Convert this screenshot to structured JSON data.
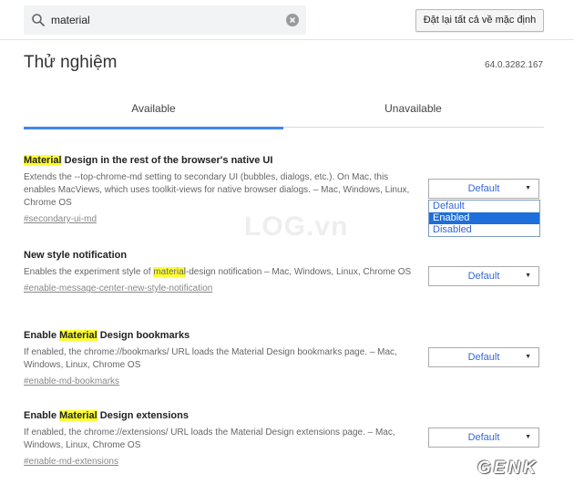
{
  "search": {
    "value": "material",
    "placeholder": ""
  },
  "toolbar": {
    "reset_label": "Đặt lại tất cả về mặc định"
  },
  "header": {
    "title": "Thử nghiệm",
    "version": "64.0.3282.167"
  },
  "tabs": [
    {
      "label": "Available",
      "active": true
    },
    {
      "label": "Unavailable",
      "active": false
    }
  ],
  "flags": [
    {
      "name_highlight": "Material",
      "name_rest": " Design in the rest of the browser's native UI",
      "description": "Extends the --top-chrome-md setting to secondary UI (bubbles, dialogs, etc.). On Mac, this enables MacViews, which uses toolkit-views for native browser dialogs. – Mac, Windows, Linux, Chrome OS",
      "link": "#secondary-ui-md",
      "select_value": "Default"
    },
    {
      "name": "New style notification",
      "desc_pre": "Enables the experiment style of ",
      "desc_highlight": "material",
      "desc_post": "-design notification – Mac, Windows, Linux, Chrome OS",
      "link": "#enable-message-center-new-style-notification",
      "select_value": "Default"
    },
    {
      "name_pre": "Enable ",
      "name_highlight": "Material",
      "name_rest": " Design bookmarks",
      "description": "If enabled, the chrome://bookmarks/ URL loads the Material Design bookmarks page. – Mac, Windows, Linux, Chrome OS",
      "link": "#enable-md-bookmarks",
      "select_value": "Default"
    },
    {
      "name_pre": "Enable ",
      "name_highlight": "Material",
      "name_rest": " Design extensions",
      "description": "If enabled, the chrome://extensions/ URL loads the Material Design extensions page. – Mac, Windows, Linux, Chrome OS",
      "link": "#enable-md-extensions",
      "select_value": "Default"
    }
  ],
  "dropdown_options": [
    "Default",
    "Enabled",
    "Disabled"
  ],
  "dropdown_selected": "Enabled",
  "watermarks": {
    "center": "LOG.vn",
    "corner": "GENK"
  },
  "colors": {
    "accent": "#4285f4",
    "highlight": "#ffff33",
    "selected_option": "#1e6fd9"
  }
}
